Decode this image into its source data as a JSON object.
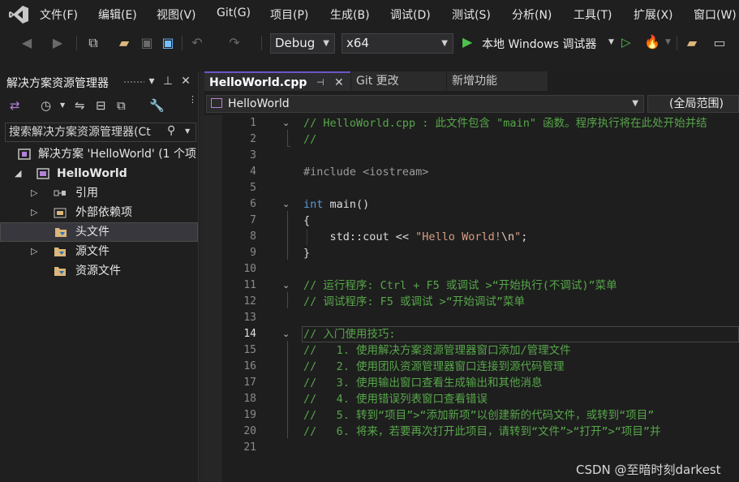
{
  "menubar": {
    "items": [
      "文件(F)",
      "编辑(E)",
      "视图(V)",
      "Git(G)",
      "项目(P)",
      "生成(B)",
      "调试(D)",
      "测试(S)",
      "分析(N)",
      "工具(T)",
      "扩展(X)",
      "窗口(W)"
    ]
  },
  "toolbar": {
    "config": "Debug",
    "platform": "x64",
    "run_label": "本地 Windows 调试器"
  },
  "solution_explorer": {
    "title": "解决方案资源管理器",
    "search_placeholder": "搜索解决方案资源管理器(Ct",
    "tree": [
      {
        "label": "解决方案 'HelloWorld' (1 个项",
        "icon": "solution-icon"
      },
      {
        "label": "HelloWorld",
        "icon": "cpp-project-icon"
      },
      {
        "label": "引用",
        "icon": "references-icon"
      },
      {
        "label": "外部依赖项",
        "icon": "external-deps-icon"
      },
      {
        "label": "头文件",
        "icon": "filter-folder-icon"
      },
      {
        "label": "源文件",
        "icon": "filter-folder-icon"
      },
      {
        "label": "资源文件",
        "icon": "filter-folder-icon"
      }
    ]
  },
  "editor": {
    "tabs": [
      {
        "label": "HelloWorld.cpp"
      },
      {
        "label": "Git 更改"
      },
      {
        "label": "新增功能"
      }
    ],
    "nav_left": "HelloWorld",
    "nav_right": "(全局范围)",
    "current_line": 14,
    "lines": [
      {
        "n": "1",
        "text": "// HelloWorld.cpp : 此文件包含 \"main\" 函数。程序执行将在此处开始并结"
      },
      {
        "n": "2",
        "text": "//"
      },
      {
        "n": "3",
        "text": ""
      },
      {
        "n": "4",
        "text": "#include <iostream>"
      },
      {
        "n": "5",
        "text": ""
      },
      {
        "n": "6",
        "kw": "int",
        "text": " main()"
      },
      {
        "n": "7",
        "text": "{"
      },
      {
        "n": "8",
        "pre": "    std::cout << ",
        "str": "\"Hello World!",
        "esc": "\\n",
        "str2": "\"",
        "post": ";"
      },
      {
        "n": "9",
        "text": "}"
      },
      {
        "n": "10",
        "text": ""
      },
      {
        "n": "11",
        "text": "// 运行程序: Ctrl + F5 或调试 >“开始执行(不调试)”菜单"
      },
      {
        "n": "12",
        "text": "// 调试程序: F5 或调试 >“开始调试”菜单"
      },
      {
        "n": "13",
        "text": ""
      },
      {
        "n": "14",
        "text": "// 入门使用技巧:"
      },
      {
        "n": "15",
        "text": "//   1. 使用解决方案资源管理器窗口添加/管理文件"
      },
      {
        "n": "16",
        "text": "//   2. 使用团队资源管理器窗口连接到源代码管理"
      },
      {
        "n": "17",
        "text": "//   3. 使用输出窗口查看生成输出和其他消息"
      },
      {
        "n": "18",
        "text": "//   4. 使用错误列表窗口查看错误"
      },
      {
        "n": "19",
        "text": "//   5. 转到“项目”>“添加新项”以创建新的代码文件，或转到“项目”"
      },
      {
        "n": "20",
        "text": "//   6. 将来，若要再次打开此项目，请转到“文件”>“打开”>“项目”并"
      },
      {
        "n": "21",
        "text": ""
      }
    ]
  },
  "watermark": "CSDN @至暗时刻darkest",
  "colors": {
    "comment": "#57a64a",
    "keyword": "#569cd6",
    "string": "#d69d85",
    "accent": "#6e56c4"
  }
}
